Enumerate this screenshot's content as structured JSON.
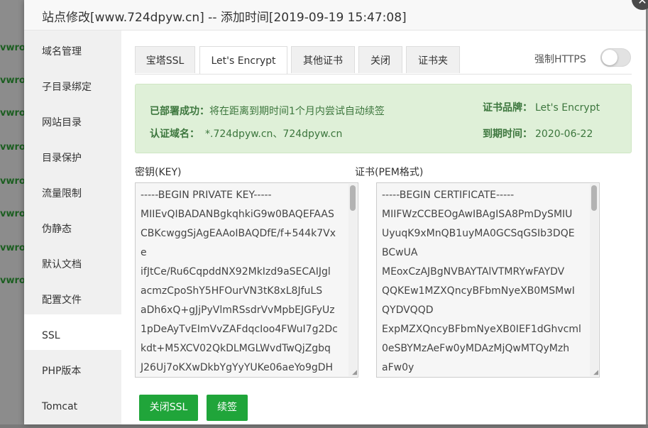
{
  "background": {
    "left_items": [
      "vwroo",
      "vwroo",
      "vwroo",
      "vwroo",
      "vwroo",
      "vwroo",
      "vwroo",
      "vwroo"
    ]
  },
  "modal": {
    "title": "站点修改[www.724dpyw.cn] -- 添加时间[2019-09-19 15:47:08]",
    "close_icon": "close-icon"
  },
  "sidebar": {
    "items": [
      {
        "label": "域名管理"
      },
      {
        "label": "子目录绑定"
      },
      {
        "label": "网站目录"
      },
      {
        "label": "目录保护"
      },
      {
        "label": "流量限制"
      },
      {
        "label": "伪静态"
      },
      {
        "label": "默认文档"
      },
      {
        "label": "配置文件"
      },
      {
        "label": "SSL"
      },
      {
        "label": "PHP版本"
      },
      {
        "label": "Tomcat"
      }
    ],
    "active": "SSL"
  },
  "tabs": [
    {
      "label": "宝塔SSL"
    },
    {
      "label": "Let's Encrypt"
    },
    {
      "label": "其他证书"
    },
    {
      "label": "关闭"
    },
    {
      "label": "证书夹"
    }
  ],
  "active_tab": "Let's Encrypt",
  "force_https": {
    "label": "强制HTTPS",
    "enabled": false
  },
  "status": {
    "deployed_label": "已部署成功：",
    "deployed_text": "将在距离到期时间1个月内尝试自动续签",
    "domains_label": "认证域名：",
    "domains_value": "*.724dpyw.cn、724dpyw.cn",
    "brand_label": "证书品牌：",
    "brand_value": "Let's Encrypt",
    "expiry_label": "到期时间：",
    "expiry_value": "2020-06-22"
  },
  "key_section": {
    "label": "密钥(KEY)",
    "content": "-----BEGIN PRIVATE KEY-----\nMIIEvQIBADANBgkqhkiG9w0BAQEFAAS\nCBKcwggSjAgEAAoIBAQDfE/f+544k7Vx\ne\nifJtCe/Ru6CqpddNX92MkIzd9aSECAIJgl\nacmzCpoShY5HFOurVN3tK8xL8JfuLS\naDh6xQ+gJjPyVlmRSsdrVvMpbEJGFyUz\n1pDeAyTvEImVvZAFdqcIoo4FWuI7g2Dc\nkdt+M5XCV02QkDLMGLWvdTwQjZgbq\nJ26Uj7oKXwDkbYgYyYUKe06aeYo9gDH"
  },
  "cert_section": {
    "label": "证书(PEM格式)",
    "content": "-----BEGIN CERTIFICATE-----\nMIIFWzCCBEOgAwIBAgISA8PmDySMIU\nUyuqK9xMnQB1uyMA0GCSqGSIb3DQE\nBCwUA\nMEoxCzAJBgNVBAYTAlVTMRYwFAYDV\nQQKEw1MZXQncyBFbmNyeXB0MSMwI\nQYDVQQD\nExpMZXQncyBFbmNyeXB0IEF1dGhvcml\n0eSBYMzAeFw0yMDAzMjQwMTQyMzh\naFw0y"
  },
  "buttons": {
    "close_ssl": "关闭SSL",
    "renew": "续签"
  },
  "colors": {
    "primary": "#20a53a",
    "success_bg": "#dff0d8",
    "success_text": "#3c763d"
  }
}
